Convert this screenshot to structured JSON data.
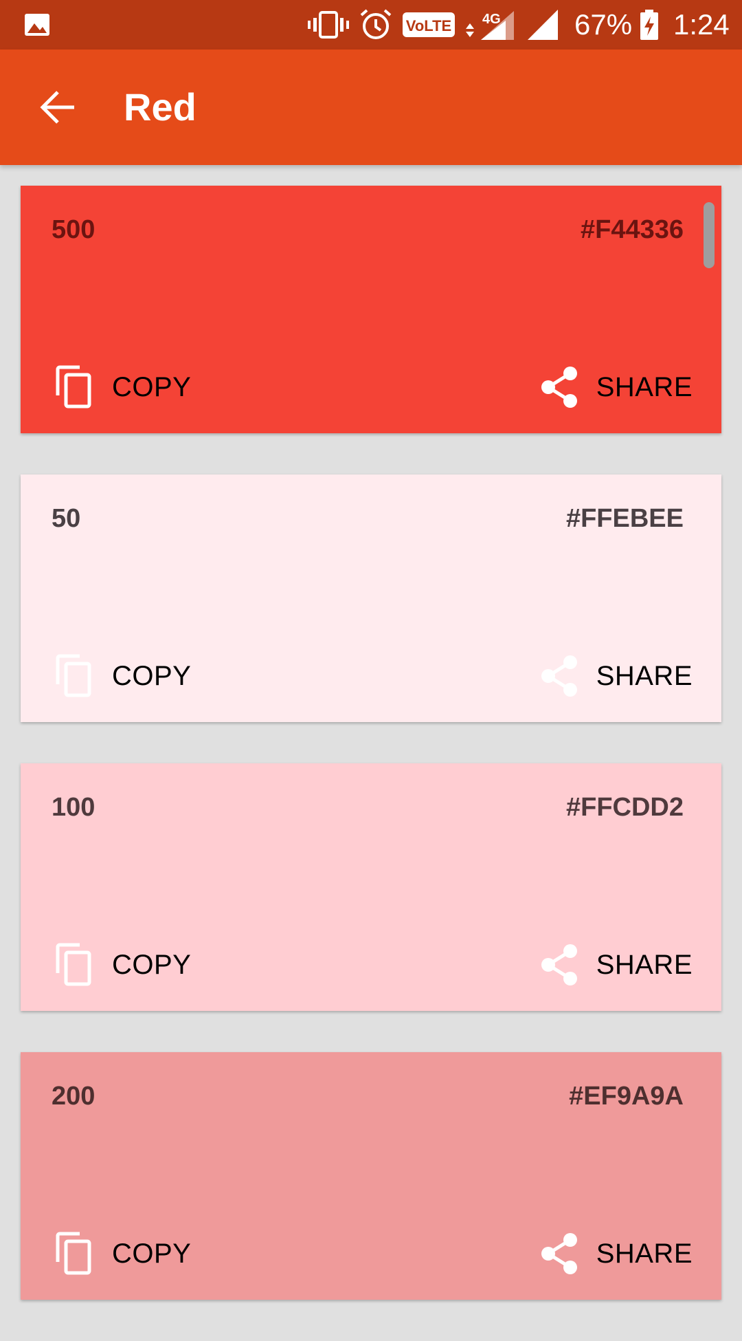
{
  "status_bar": {
    "battery": "67%",
    "time": "1:24",
    "network": "4G",
    "volte": "VoLTE",
    "icons": [
      "gallery-icon",
      "vibrate-icon",
      "alarm-icon",
      "volte-icon",
      "data-arrows-icon",
      "signal-4g-icon",
      "signal-icon",
      "battery-charging-icon"
    ]
  },
  "app_bar": {
    "title": "Red",
    "back_icon": "arrow-back-icon"
  },
  "colors": {
    "status_bar": "#B73913",
    "app_bar": "#E54B19",
    "background": "#E0E0E0"
  },
  "swatches": [
    {
      "shade": "500",
      "hex": "#F44336",
      "color": "#F44336",
      "text_color": "#6B1410",
      "copy_label": "COPY",
      "share_label": "SHARE",
      "icon_color": "#FFFFFF"
    },
    {
      "shade": "50",
      "hex": "#FFEBEE",
      "color": "#FFEBEE",
      "text_color": "#4A4044",
      "copy_label": "COPY",
      "share_label": "SHARE",
      "icon_color": "#FFFFFF"
    },
    {
      "shade": "100",
      "hex": "#FFCDD2",
      "color": "#FFCDD2",
      "text_color": "#4F3A3D",
      "copy_label": "COPY",
      "share_label": "SHARE",
      "icon_color": "#FFFFFF"
    },
    {
      "shade": "200",
      "hex": "#EF9A9A",
      "color": "#EF9A9A",
      "text_color": "#4E2F2F",
      "copy_label": "COPY",
      "share_label": "SHARE",
      "icon_color": "#FFFFFF"
    }
  ]
}
